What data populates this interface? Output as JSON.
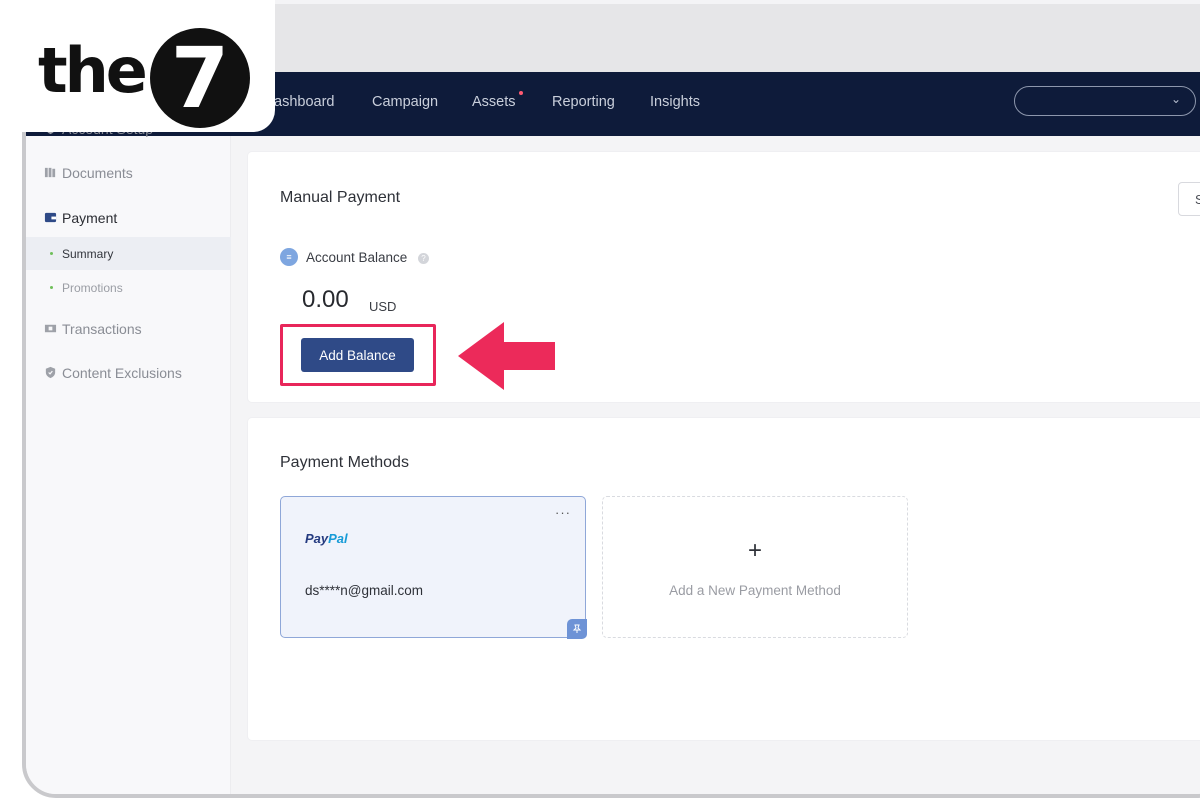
{
  "brand": {
    "logo_text": "the",
    "logo_mark": "7"
  },
  "nav": {
    "items": [
      "ashboard",
      "Campaign",
      "Assets",
      "Reporting",
      "Insights"
    ],
    "account_select_value": ""
  },
  "sidebar": {
    "items": [
      {
        "label": "Account Setup",
        "icon": "gear-shield-icon"
      },
      {
        "label": "Documents",
        "icon": "documents-icon"
      },
      {
        "label": "Payment",
        "icon": "wallet-icon"
      },
      {
        "label": "Transactions",
        "icon": "transactions-icon"
      },
      {
        "label": "Content Exclusions",
        "icon": "shield-icon"
      }
    ],
    "payment_sub": [
      "Summary",
      "Promotions"
    ]
  },
  "manual_payment": {
    "title": "Manual Payment",
    "settings_button_label": "S",
    "balance_label": "Account Balance",
    "balance_icon": "≡",
    "help_icon": "?",
    "balance_value": "0.00",
    "balance_unit": "USD",
    "add_balance_label": "Add Balance"
  },
  "payment_methods": {
    "title": "Payment Methods",
    "methods": [
      {
        "brand_part1": "Pay",
        "brand_part2": "Pal",
        "account": "ds****n@gmail.com",
        "more": "···"
      }
    ],
    "add_new_label": "Add a New Payment Method",
    "add_symbol": "+"
  },
  "colors": {
    "nav_bg": "#0e1b3a",
    "primary_button": "#2f4a87",
    "highlight": "#e8265a",
    "selected_card_border": "#8fa7d8"
  }
}
